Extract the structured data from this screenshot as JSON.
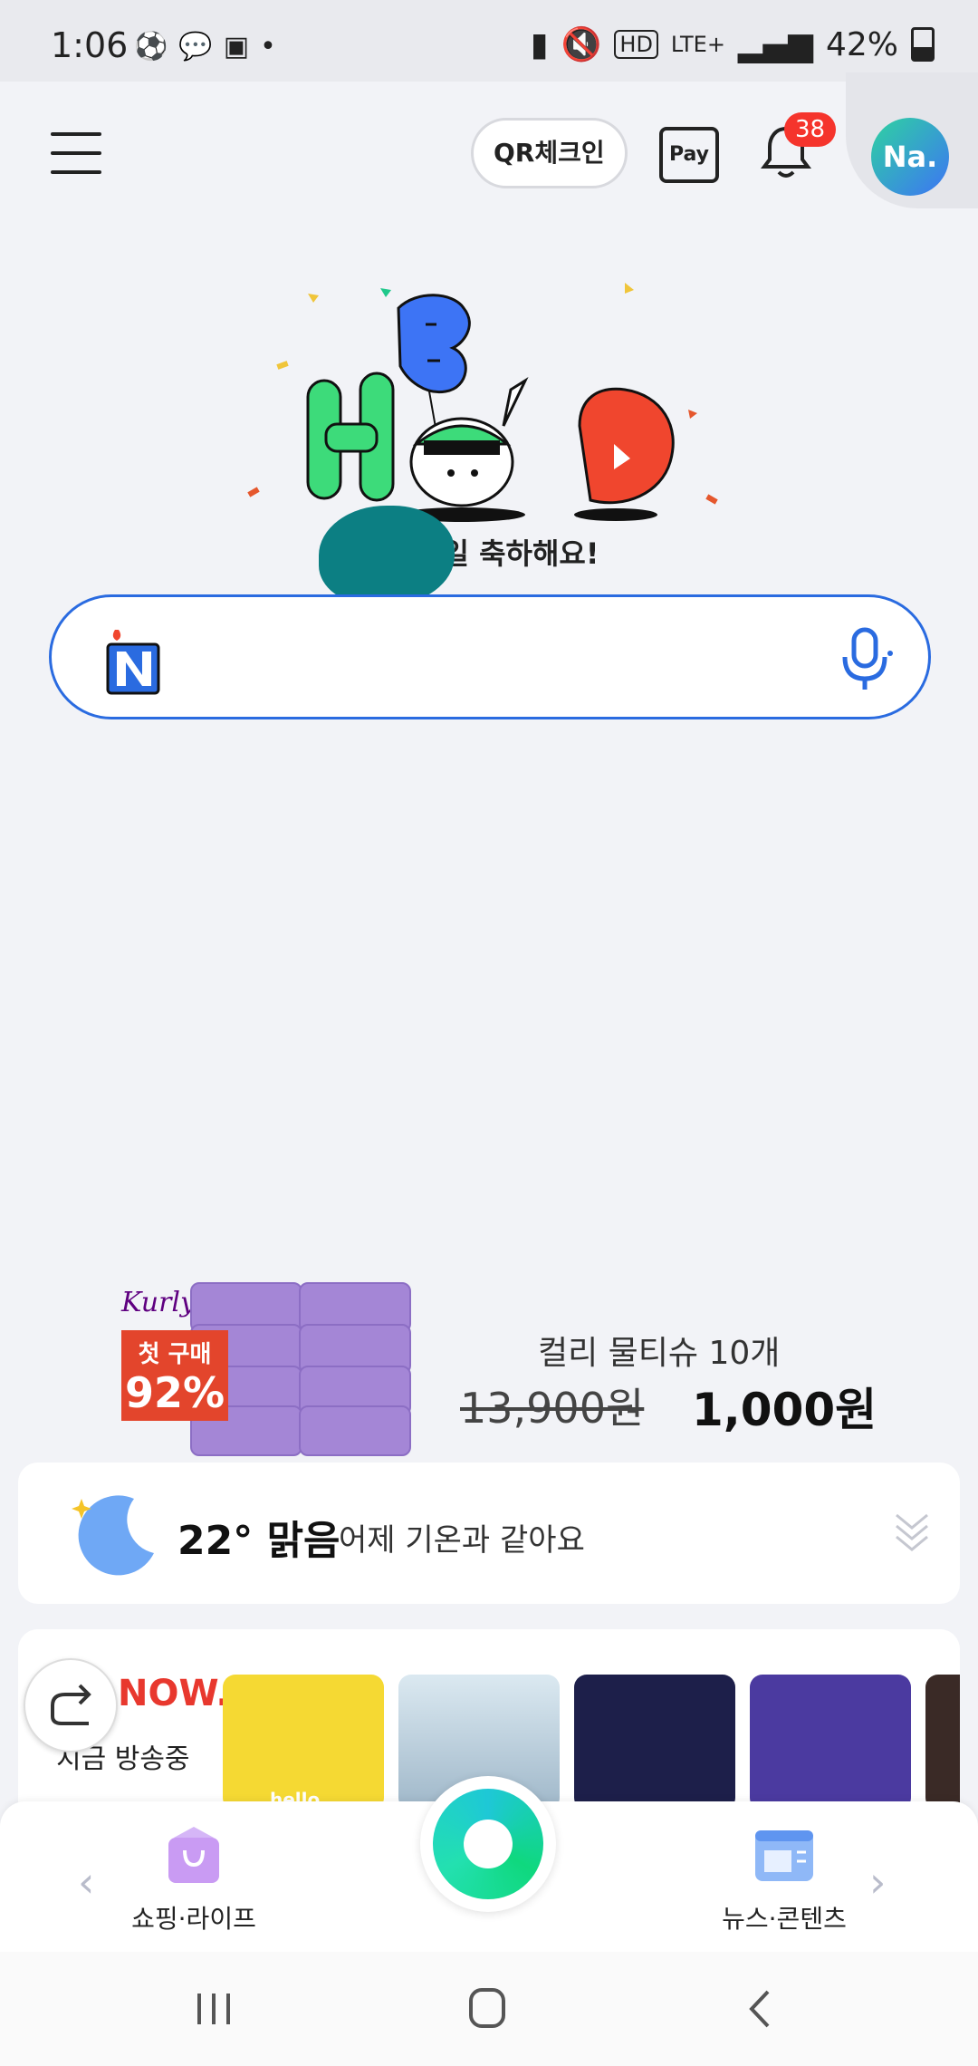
{
  "status_bar": {
    "time": "1:06",
    "left_icons": [
      "soccer-icon",
      "talk-icon",
      "twitch-icon",
      "dot"
    ],
    "hd": "HD",
    "network": "LTE+",
    "battery": "42%"
  },
  "header": {
    "qr_label": "QR체크인",
    "pay_label": "Pay",
    "notification_count": "38",
    "avatar_label": "Na."
  },
  "birthday": {
    "message": "님 생일 축하해요!",
    "balloon_letters": [
      "H",
      "B",
      "D"
    ]
  },
  "search": {
    "placeholder": ""
  },
  "ad": {
    "brand": "Kurly",
    "tag_line1": "첫 구매",
    "tag_line2": "92%",
    "title": "컬리 물티슈 10개",
    "old_price": "13,900원",
    "new_price": "1,000원"
  },
  "weather": {
    "temperature": "22°",
    "condition": "맑음",
    "comparison": "어제 기온과 같아요"
  },
  "live": {
    "logo": "NOW.",
    "label": "지금 방송중",
    "thumbnails": [
      {
        "caption": "hello",
        "color": "#f5d933"
      },
      {
        "caption": "",
        "color": "#cfe3ef"
      },
      {
        "caption": "",
        "color": "#1d1f4a"
      },
      {
        "caption": "",
        "color": "#4b3aa0"
      },
      {
        "caption": "",
        "color": "#3a2a26"
      }
    ]
  },
  "bottom_nav": {
    "left_label": "쇼핑·라이프",
    "right_label": "뉴스·콘텐츠"
  },
  "colors": {
    "accent_blue": "#2a6be0",
    "badge_red": "#f5342c",
    "green": "#0fd87e"
  }
}
